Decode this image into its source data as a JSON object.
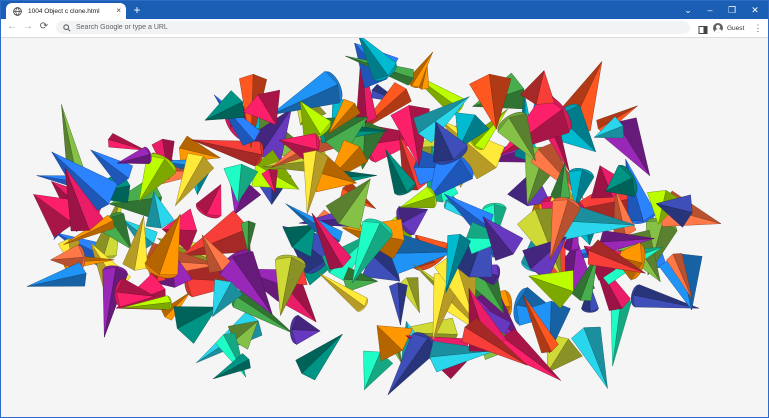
{
  "browser": {
    "tab_title": "1004 Object c clone.html",
    "tab_close_glyph": "×",
    "new_tab_glyph": "+",
    "window_controls": {
      "dropdown": "⌄",
      "minimize": "–",
      "restore": "❐",
      "close": "✕"
    },
    "nav": {
      "back": "←",
      "forward": "→",
      "reload": "⟳"
    },
    "omnibox_placeholder": "Search Google or type a URL",
    "profile_label": "Guest",
    "menu_glyph": "⋮",
    "icons": [
      "globe-icon",
      "search-icon",
      "side-panel-icon",
      "avatar-icon",
      "kebab-menu-icon"
    ]
  },
  "scene": {
    "background": "#f5f5f5",
    "palette": [
      "#e53935",
      "#8e24aa",
      "#3949ab",
      "#1e88e5",
      "#00acc1",
      "#26c6da",
      "#43a047",
      "#7cb342",
      "#c0ca33",
      "#fdd835",
      "#fb8c00",
      "#f4511e",
      "#e91e63",
      "#d81b60",
      "#5e35b1",
      "#00897b",
      "#1de9b6",
      "#aeea00",
      "#ff7043",
      "#2979ff"
    ]
  }
}
